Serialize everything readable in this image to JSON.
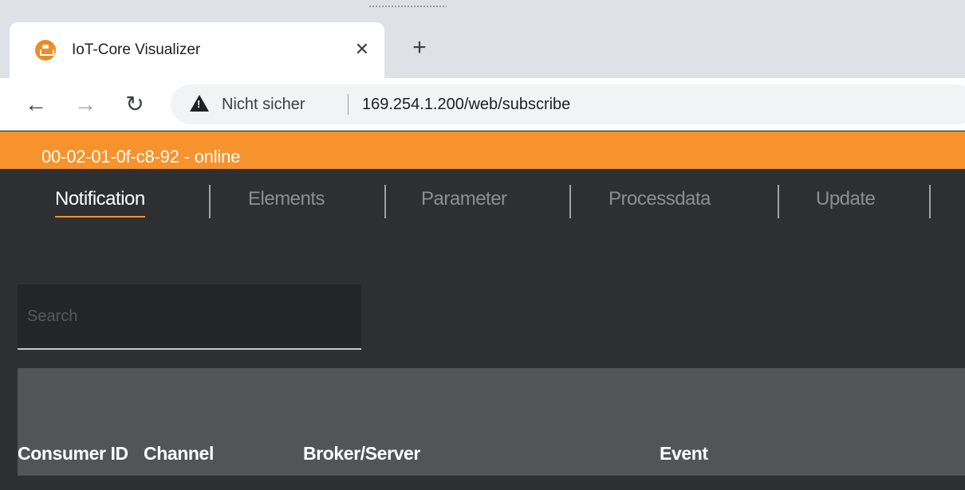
{
  "browser": {
    "tab": {
      "title": "IoT-Core Visualizer",
      "favicon": "ifm-device-icon",
      "close_glyph": "✕"
    },
    "new_tab_glyph": "+",
    "nav": {
      "back_glyph": "←",
      "forward_glyph": "→",
      "reload_glyph": "↻"
    },
    "address": {
      "security_label": "Nicht sicher",
      "url": "169.254.1.200/web/subscribe"
    }
  },
  "app": {
    "device_status": "00-02-01-0f-c8-92 - online",
    "colors": {
      "accent": "#f7932d",
      "background": "#2d2f31",
      "table_header": "#525456"
    },
    "nav_tabs": [
      {
        "label": "Notification",
        "active": true
      },
      {
        "label": "Elements",
        "active": false
      },
      {
        "label": "Parameter",
        "active": false
      },
      {
        "label": "Processdata",
        "active": false
      },
      {
        "label": "Update",
        "active": false
      }
    ],
    "search": {
      "placeholder": "Search",
      "value": ""
    },
    "table": {
      "columns": [
        "Consumer ID",
        "Channel",
        "Broker/Server",
        "Event"
      ]
    }
  }
}
